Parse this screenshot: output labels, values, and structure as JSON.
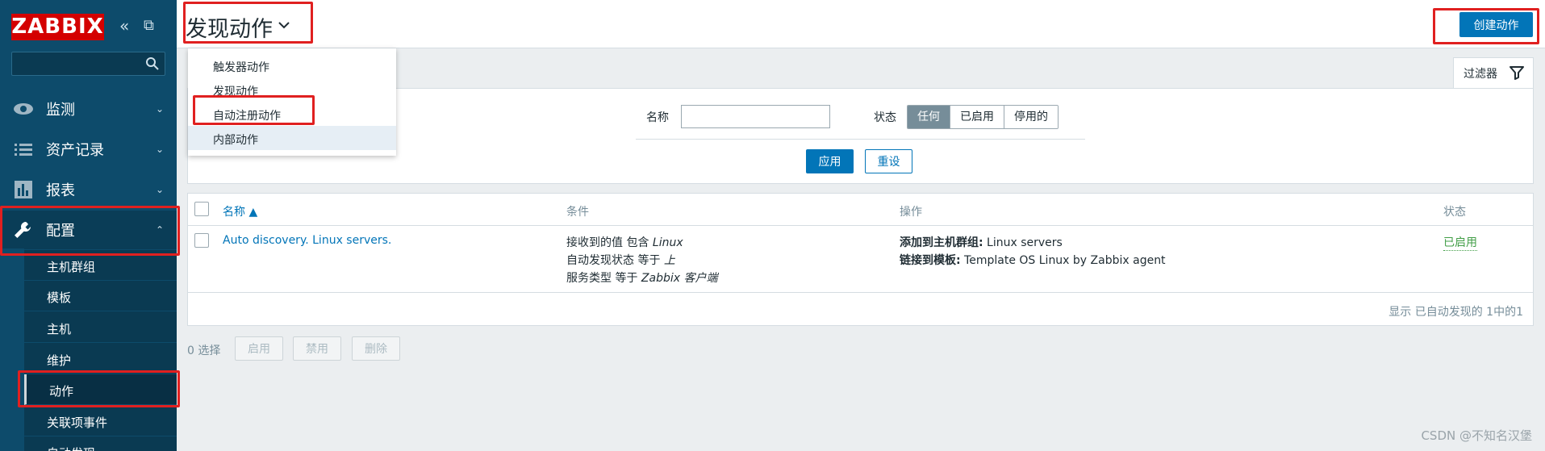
{
  "sidebar": {
    "logo": "ZABBIX",
    "collapse_icon": "«",
    "detach_icon": "⧉",
    "search_placeholder": "",
    "nav": [
      {
        "label": "监测",
        "icon": "eye-icon",
        "expanded": false
      },
      {
        "label": "资产记录",
        "icon": "list-icon",
        "expanded": false
      },
      {
        "label": "报表",
        "icon": "bar-chart-icon",
        "expanded": false
      },
      {
        "label": "配置",
        "icon": "wrench-icon",
        "expanded": true
      }
    ],
    "submenu": [
      "主机群组",
      "模板",
      "主机",
      "维护",
      "动作",
      "关联项事件",
      "自动发现"
    ],
    "active_submenu": "动作"
  },
  "header": {
    "title": "发现动作",
    "create_button": "创建动作"
  },
  "dropdown": {
    "items": [
      "触发器动作",
      "发现动作",
      "自动注册动作",
      "内部动作"
    ],
    "hovered": "内部动作"
  },
  "filter": {
    "tab_label": "过滤器",
    "name_label": "名称",
    "name_value": "",
    "status_label": "状态",
    "status_options": [
      "任何",
      "已启用",
      "停用的"
    ],
    "status_selected": "任何",
    "apply": "应用",
    "reset": "重设"
  },
  "table": {
    "columns": [
      "名称 ▲",
      "条件",
      "操作",
      "状态"
    ],
    "rows": [
      {
        "name": "Auto discovery. Linux servers.",
        "conditions": [
          {
            "text": "接收到的值 包含 ",
            "value": "Linux"
          },
          {
            "text": "自动发现状态 等于 ",
            "value": "上"
          },
          {
            "text": "服务类型 等于 ",
            "value": "Zabbix 客户端"
          }
        ],
        "operations": [
          {
            "key": "添加到主机群组:",
            "value": " Linux servers"
          },
          {
            "key": "链接到模板:",
            "value": " Template OS Linux by Zabbix agent"
          }
        ],
        "status": "已启用"
      }
    ],
    "summary": "显示 已自动发现的 1中的1"
  },
  "footer": {
    "selected": "0 选择",
    "buttons": [
      "启用",
      "禁用",
      "删除"
    ]
  },
  "watermark": "CSDN @不知名汉堡",
  "colors": {
    "sidebar_bg": "#0d4b6b",
    "logo_red": "#d40000",
    "primary_blue": "#0275b8",
    "status_green": "#429e47",
    "annotation_red": "#e02020"
  }
}
